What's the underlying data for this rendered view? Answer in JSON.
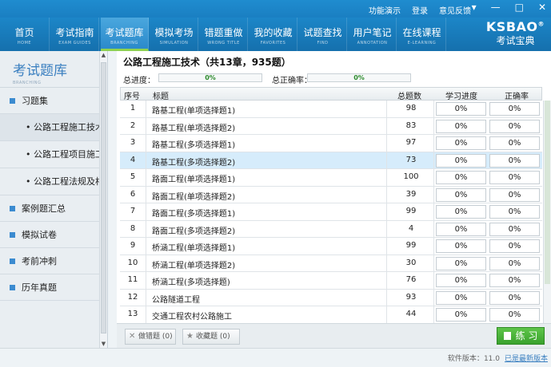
{
  "top_links": [
    "功能演示",
    "登录",
    "意见反馈"
  ],
  "window_controls": {
    "min": "—",
    "max": "□",
    "close": "✕",
    "menu": "▾"
  },
  "nav": [
    {
      "cn": "首页",
      "en": "HOME"
    },
    {
      "cn": "考试指南",
      "en": "EXAM GUIDES"
    },
    {
      "cn": "考试题库",
      "en": "BRANCHING"
    },
    {
      "cn": "模拟考场",
      "en": "SIMULATION"
    },
    {
      "cn": "错题重做",
      "en": "WRONG TITLE"
    },
    {
      "cn": "我的收藏",
      "en": "FAVORITES"
    },
    {
      "cn": "试题查找",
      "en": "FIND"
    },
    {
      "cn": "用户笔记",
      "en": "ANNOTATION"
    },
    {
      "cn": "在线课程",
      "en": "E-LEARNING"
    }
  ],
  "logo": {
    "brand": "KSBAO",
    "reg": "®",
    "cn": "考试宝典"
  },
  "sidebar": {
    "title": "考试题库",
    "title_en": "BRANCHING",
    "groups": [
      {
        "label": "习题集",
        "expanded": true,
        "children": [
          "公路工程施工技术",
          "公路工程项目施工管",
          "公路工程法规及相关"
        ]
      },
      {
        "label": "案例题汇总"
      },
      {
        "label": "模拟试卷"
      },
      {
        "label": "考前冲刺"
      },
      {
        "label": "历年真题"
      }
    ]
  },
  "main": {
    "title": "公路工程施工技术（共13章，935题）",
    "progress_label": "总进度：",
    "progress_value": "0%",
    "accuracy_label": "总正确率：",
    "accuracy_value": "0%",
    "columns": [
      "序号",
      "标题",
      "总题数",
      "学习进度",
      "正确率"
    ],
    "rows": [
      {
        "n": "1",
        "title": "路基工程(单项选择题1)",
        "count": "98",
        "study": "0%",
        "acc": "0%"
      },
      {
        "n": "2",
        "title": "路基工程(单项选择题2)",
        "count": "83",
        "study": "0%",
        "acc": "0%"
      },
      {
        "n": "3",
        "title": "路基工程(多项选择题1)",
        "count": "97",
        "study": "0%",
        "acc": "0%"
      },
      {
        "n": "4",
        "title": "路基工程(多项选择题2)",
        "count": "73",
        "study": "0%",
        "acc": "0%"
      },
      {
        "n": "5",
        "title": "路面工程(单项选择题1)",
        "count": "100",
        "study": "0%",
        "acc": "0%"
      },
      {
        "n": "6",
        "title": "路面工程(单项选择题2)",
        "count": "39",
        "study": "0%",
        "acc": "0%"
      },
      {
        "n": "7",
        "title": "路面工程(多项选择题1)",
        "count": "99",
        "study": "0%",
        "acc": "0%"
      },
      {
        "n": "8",
        "title": "路面工程(多项选择题2)",
        "count": "4",
        "study": "0%",
        "acc": "0%"
      },
      {
        "n": "9",
        "title": "桥涵工程(单项选择题1)",
        "count": "99",
        "study": "0%",
        "acc": "0%"
      },
      {
        "n": "10",
        "title": "桥涵工程(单项选择题2)",
        "count": "30",
        "study": "0%",
        "acc": "0%"
      },
      {
        "n": "11",
        "title": "桥涵工程(多项选择题)",
        "count": "76",
        "study": "0%",
        "acc": "0%"
      },
      {
        "n": "12",
        "title": "公路隧道工程",
        "count": "93",
        "study": "0%",
        "acc": "0%"
      },
      {
        "n": "13",
        "title": "交通工程农村公路施工",
        "count": "44",
        "study": "0%",
        "acc": "0%"
      }
    ],
    "wrong_btn": "做错题 (0)",
    "fav_btn": "收藏题 (0)",
    "practice_btn": "练 习"
  },
  "status": {
    "version_label": "软件版本：",
    "version": "11.0",
    "latest": "已是最新版本"
  },
  "colors": {
    "nav": "#1a7fc2",
    "active_tab_underline": "#8fd14f",
    "practice": "#3aa22d",
    "selected_row": "#d6ecfb"
  }
}
